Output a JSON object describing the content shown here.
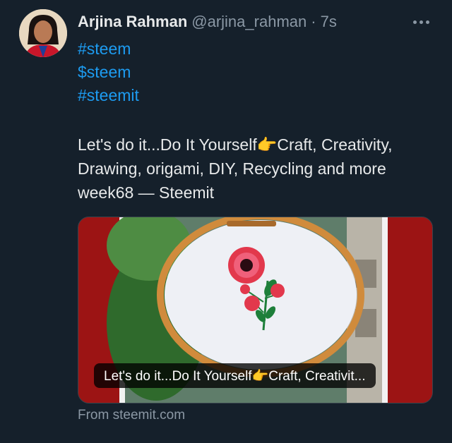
{
  "tweet": {
    "author_name": "Arjina Rahman",
    "handle": "@arjina_rahman",
    "separator": "·",
    "time": "7s",
    "hashtags": [
      "#steem",
      "$steem",
      "#steemit"
    ],
    "text": "Let's do it...Do It Yourself👉Craft, Creativity, Drawing, origami, DIY, Recycling and more week68 — Steemit",
    "link_card": {
      "title": "Let's do it...Do It Yourself👉Craft, Creativit...",
      "source": "From steemit.com"
    }
  },
  "icons": {
    "more": "more-horizontal-icon",
    "avatar": "profile-photo",
    "card_image": "embroidery-hoop-flower-photo"
  },
  "colors": {
    "background": "#15202b",
    "link": "#1d9bf0",
    "secondary_text": "#8b98a5",
    "card_frame_red": "#b01b1b",
    "hoop_wood": "#d08b3c",
    "flower": "#e2384c",
    "leaf": "#1e7f3a"
  }
}
